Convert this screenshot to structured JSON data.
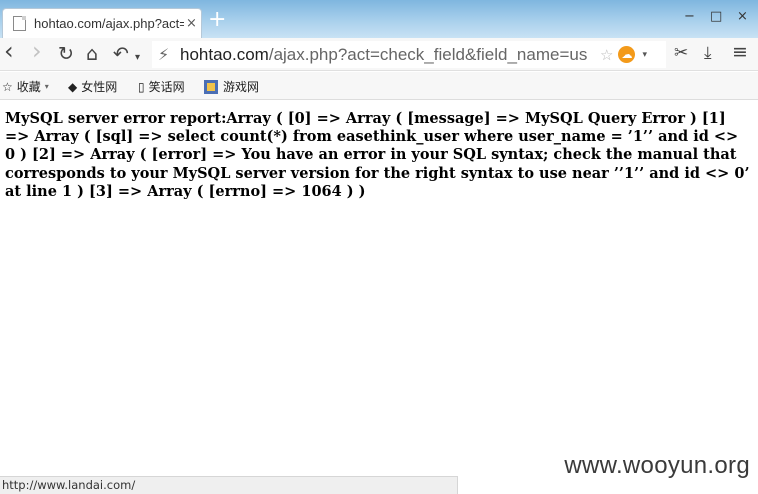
{
  "browser": {
    "tab": {
      "title": "hohtao.com/ajax.php?act=",
      "close": "×",
      "favicon": "page-icon"
    },
    "new_tab": "+",
    "window_controls": {
      "minimize": "−",
      "maximize": "□",
      "close": "×"
    },
    "nav": {
      "back": "‹",
      "forward": "›",
      "reload": "↻",
      "home": "⌂",
      "undo": "↶",
      "undo_dd": "▾"
    },
    "address": {
      "host": "hohtao.com",
      "path": "/ajax.php?act=check_field&field_name=us",
      "star": "☆",
      "cloud": "☁",
      "dropdown": "▾"
    },
    "tools": {
      "cut": "✂",
      "download": "⤓",
      "menu": "≡"
    },
    "bookmarks": [
      {
        "label": "收藏",
        "icon": "star-icon",
        "glyph": "☆",
        "caret": "▾"
      },
      {
        "label": "女性网",
        "icon": "site-icon",
        "glyph": "◆"
      },
      {
        "label": "笑话网",
        "icon": "page-icon",
        "glyph": "▯"
      },
      {
        "label": "游戏网",
        "icon": "game-icon",
        "glyph": ""
      }
    ]
  },
  "page": {
    "text": "MySQL server error report:Array ( [0] => Array ( [message] => MySQL Query Error ) [1] => Array ( [sql] => select count(*) from easethink_user where user_name = ’1’’ and id <> 0 ) [2] => Array ( [error] => You have an error in your SQL syntax; check the manual that corresponds to your MySQL server version for the right syntax to use near ’’1’’ and id <> 0’ at line 1 ) [3] => Array ( [errno] => 1064 ) )"
  },
  "status": {
    "url": "http://www.landai.com/"
  },
  "watermark": "www.wooyun.org"
}
